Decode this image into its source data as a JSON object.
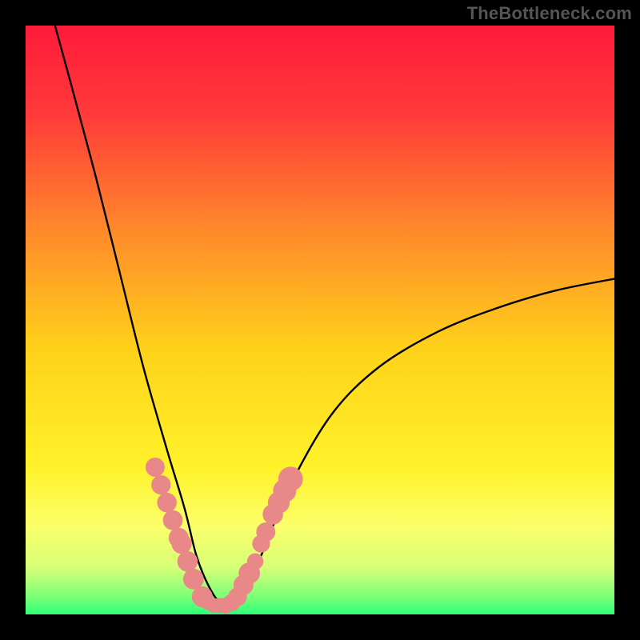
{
  "watermark": "TheBottleneck.com",
  "colors": {
    "background": "#000000",
    "gradient_stops": [
      {
        "offset": 0.0,
        "color": "#ff1a3a"
      },
      {
        "offset": 0.15,
        "color": "#ff3a3a"
      },
      {
        "offset": 0.35,
        "color": "#ff8a2a"
      },
      {
        "offset": 0.55,
        "color": "#ffd21a"
      },
      {
        "offset": 0.75,
        "color": "#fff22a"
      },
      {
        "offset": 0.85,
        "color": "#fbff6a"
      },
      {
        "offset": 0.92,
        "color": "#d8ff78"
      },
      {
        "offset": 0.97,
        "color": "#7cff78"
      },
      {
        "offset": 1.0,
        "color": "#2cff78"
      }
    ],
    "curve": "#000000",
    "marker_fill": "#e98888",
    "marker_stroke": "#d36d6d"
  },
  "chart_data": {
    "type": "line",
    "title": "",
    "xlabel": "",
    "ylabel": "",
    "xlim": [
      0,
      100
    ],
    "ylim": [
      0,
      100
    ],
    "grid": false,
    "legend": false,
    "series": [
      {
        "name": "bottleneck-curve",
        "x": [
          5,
          8,
          12,
          16,
          20,
          24,
          27,
          29,
          31,
          33,
          35,
          37,
          40,
          45,
          52,
          60,
          70,
          80,
          90,
          100
        ],
        "y": [
          100,
          89,
          74,
          58,
          42,
          28,
          18,
          10,
          5,
          2,
          2,
          4,
          10,
          22,
          34,
          42,
          48,
          52,
          55,
          57
        ]
      }
    ],
    "markers": {
      "name": "highlight-points",
      "x": [
        22,
        23,
        24,
        25,
        26,
        26.5,
        27.5,
        28.5,
        30,
        31,
        32,
        33,
        34,
        35,
        36,
        37,
        38,
        39,
        40,
        40.8,
        42,
        43,
        44,
        45
      ],
      "y": [
        25,
        22,
        19,
        16,
        13,
        12,
        9,
        6,
        3,
        2,
        1.5,
        1.5,
        1.5,
        2,
        3,
        5,
        7,
        9,
        12,
        14,
        17,
        19,
        21,
        23
      ],
      "radius_range": [
        8,
        14
      ]
    }
  }
}
